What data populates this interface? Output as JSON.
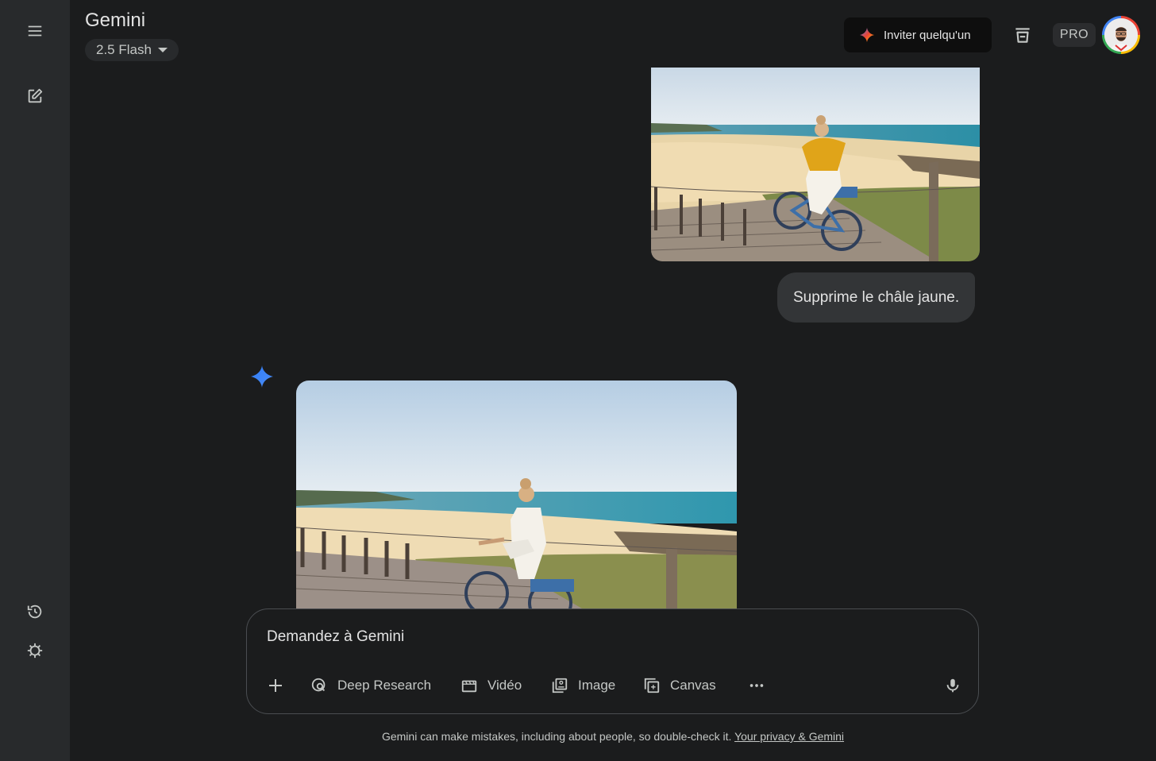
{
  "header": {
    "app_title": "Gemini",
    "model_label": "2.5 Flash",
    "invite_label": "Inviter quelqu'un",
    "pro_badge": "PRO"
  },
  "sidebar": {
    "icons": [
      "menu-icon",
      "new-chat-icon",
      "history-icon",
      "settings-icon"
    ]
  },
  "conversation": {
    "user_message": "Supprime le châle jaune.",
    "user_image_desc": "woman-on-bike-with-yellow-shawl",
    "reply_image_desc": "woman-on-bike-without-shawl"
  },
  "input": {
    "placeholder": "Demandez à Gemini",
    "tools": {
      "deep_research": "Deep Research",
      "video": "Vidéo",
      "image": "Image",
      "canvas": "Canvas"
    }
  },
  "footer": {
    "disclaimer": "Gemini can make mistakes, including about people, so double-check it.",
    "privacy_link": "Your privacy & Gemini"
  },
  "colors": {
    "background": "#1b1c1d",
    "sidebar": "#282a2c",
    "bubble": "#333537",
    "accent_blue": "#4285f4"
  }
}
